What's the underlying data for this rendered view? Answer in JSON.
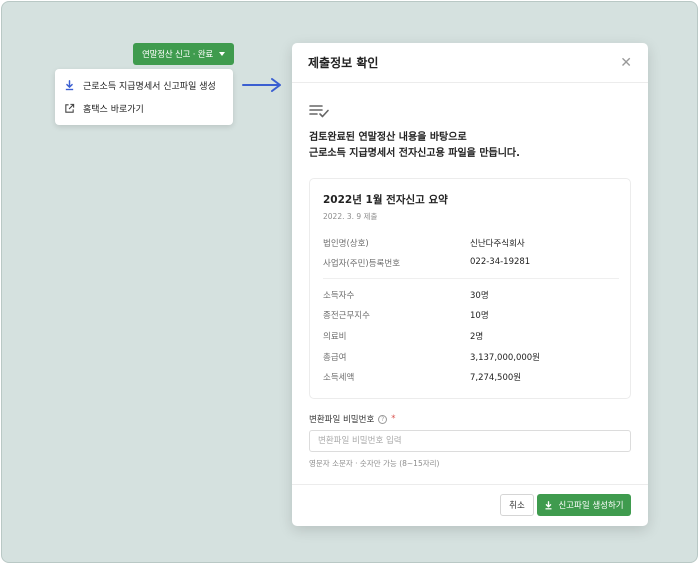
{
  "trigger": {
    "label": "연말정산 신고 · 완료"
  },
  "menu": {
    "items": [
      {
        "label": "근로소득 지급명세서 신고파일 생성",
        "icon": "download-icon"
      },
      {
        "label": "홈택스 바로가기",
        "icon": "external-link-icon"
      }
    ]
  },
  "modal": {
    "title": "제출정보 확인",
    "lead_line1": "검토완료된 연말정산 내용을 바탕으로",
    "lead_line2": "근로소득 지급명세서 전자신고용 파일을 만듭니다.",
    "summary": {
      "title": "2022년 1월 전자신고 요약",
      "date": "2022. 3. 9 제출",
      "company": [
        {
          "label": "법인명(상호)",
          "value": "신난다주식회사"
        },
        {
          "label": "사업자(주민)등록번호",
          "value": "022-34-19281"
        }
      ],
      "stats": [
        {
          "label": "소득자수",
          "value": "30명"
        },
        {
          "label": "종전근무지수",
          "value": "10명"
        },
        {
          "label": "의료비",
          "value": "2명"
        },
        {
          "label": "총급여",
          "value": "3,137,000,000원"
        },
        {
          "label": "소득세액",
          "value": "7,274,500원"
        }
      ]
    },
    "password": {
      "label": "변환파일 비밀번호",
      "required_mark": "*",
      "placeholder": "변환파일 비밀번호 입력",
      "value": "",
      "hint": "영문자 소문자 · 숫자만 가능 (8~15자리)"
    },
    "buttons": {
      "cancel": "취소",
      "submit": "신고파일 생성하기"
    }
  },
  "colors": {
    "accent": "#3f9b4e",
    "arrow": "#3b5fd1",
    "backdrop": "#d5e1df"
  }
}
